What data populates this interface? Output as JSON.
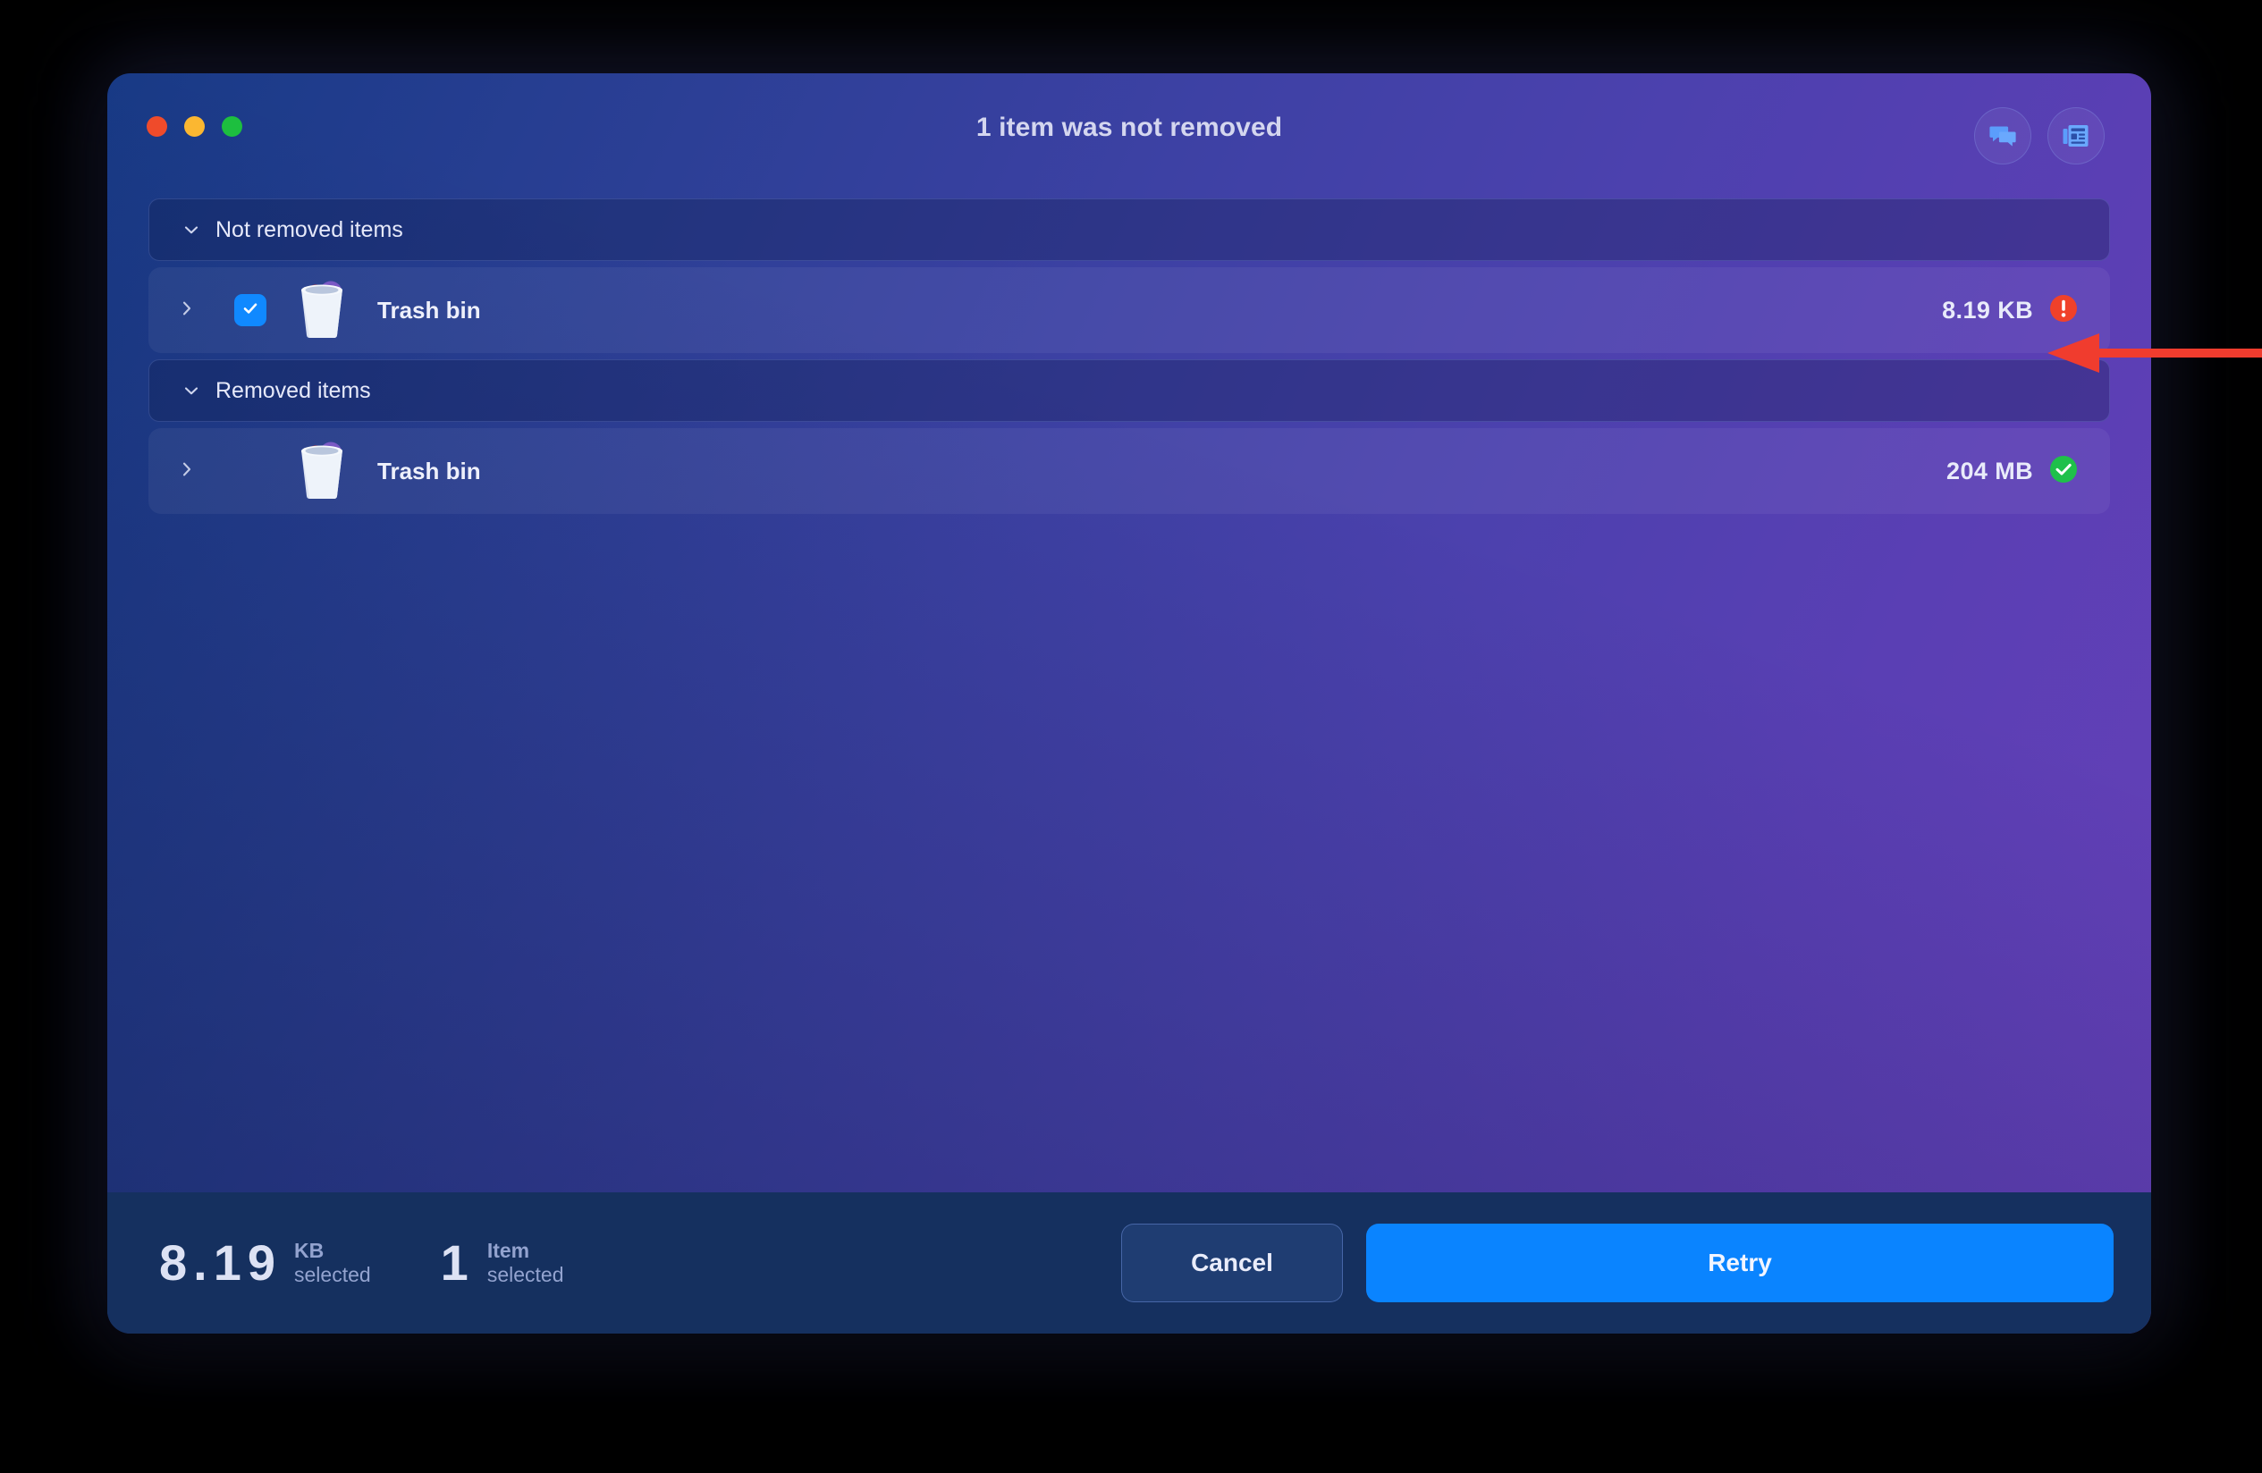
{
  "window": {
    "title": "1 item was not removed",
    "traffic_lights": [
      "close",
      "minimize",
      "maximize"
    ]
  },
  "title_actions": [
    {
      "name": "feedback-icon",
      "icon": "chat-bubbles-icon"
    },
    {
      "name": "news-icon",
      "icon": "newspaper-icon"
    }
  ],
  "sections": [
    {
      "label": "Not removed items",
      "expanded": true,
      "items": [
        {
          "name": "Trash bin",
          "size": "8.19 KB",
          "status": "error",
          "has_checkbox": true,
          "checked": true,
          "icon": "trash-bin-icon"
        }
      ]
    },
    {
      "label": "Removed items",
      "expanded": true,
      "items": [
        {
          "name": "Trash bin",
          "size": "204 MB",
          "status": "success",
          "has_checkbox": false,
          "checked": false,
          "icon": "trash-bin-icon"
        }
      ]
    }
  ],
  "footer": {
    "size_stat": {
      "value": "8.19",
      "unit": "KB",
      "sub": "selected"
    },
    "count_stat": {
      "value": "1",
      "unit": "Item",
      "sub": "selected"
    },
    "cancel_label": "Cancel",
    "retry_label": "Retry"
  },
  "colors": {
    "accent_blue": "#0a84ff",
    "error_red": "#f0412a",
    "success_green": "#1fc04a",
    "footer_bg": "#15305f",
    "annotation_red": "#f03c2e"
  },
  "annotation": {
    "type": "left-arrow",
    "color": "#f03c2e"
  }
}
